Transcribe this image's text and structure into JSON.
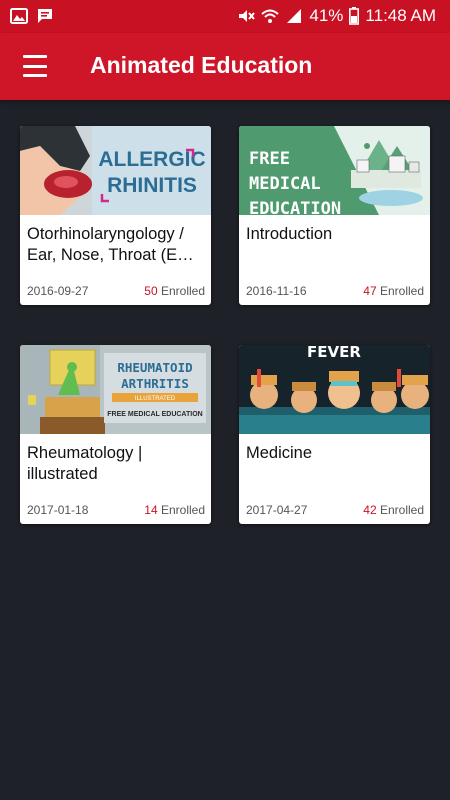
{
  "status_bar": {
    "battery": "41%",
    "time": "11:48 AM",
    "left_icons": [
      "image-icon",
      "chat-icon"
    ],
    "right_icons": [
      "mute-icon",
      "wifi-icon",
      "signal-icon",
      "battery-icon"
    ]
  },
  "app_bar": {
    "title": "Animated Education",
    "menu_icon": "hamburger-menu-icon"
  },
  "colors": {
    "primary": "#cf1528",
    "background": "#1e2127",
    "enrolled_number": "#c81224"
  },
  "courses": [
    {
      "title": "Otorhinolaryngology / Ear, Nose, Throat (EN…",
      "title_line1": "Otorhinolaryngology /",
      "title_line2": "Ear, Nose, Throat (EN…",
      "date": "2016-09-27",
      "enrolled_count": "50",
      "enrolled_label": "Enrolled",
      "thumb_text_1": "ALLERGIC",
      "thumb_text_2": "RHINITIS"
    },
    {
      "title": "Introduction",
      "date": "2016-11-16",
      "enrolled_count": "47",
      "enrolled_label": "Enrolled",
      "thumb_text_1": "FREE",
      "thumb_text_2": "MEDICAL",
      "thumb_text_3": "EDUCATION"
    },
    {
      "title": "Rheumatology | illustrated",
      "title_line1": "Rheumatology |",
      "title_line2": "illustrated",
      "date": "2017-01-18",
      "enrolled_count": "14",
      "enrolled_label": "Enrolled",
      "thumb_text_1": "RHEUMATOID",
      "thumb_text_2": "ARTHRITIS",
      "thumb_text_3": "ILLUSTRATED",
      "thumb_text_4": "FREE MEDICAL EDUCATION"
    },
    {
      "title": "Medicine",
      "date": "2017-04-27",
      "enrolled_count": "42",
      "enrolled_label": "Enrolled",
      "thumb_text_1": "FEVER"
    }
  ]
}
